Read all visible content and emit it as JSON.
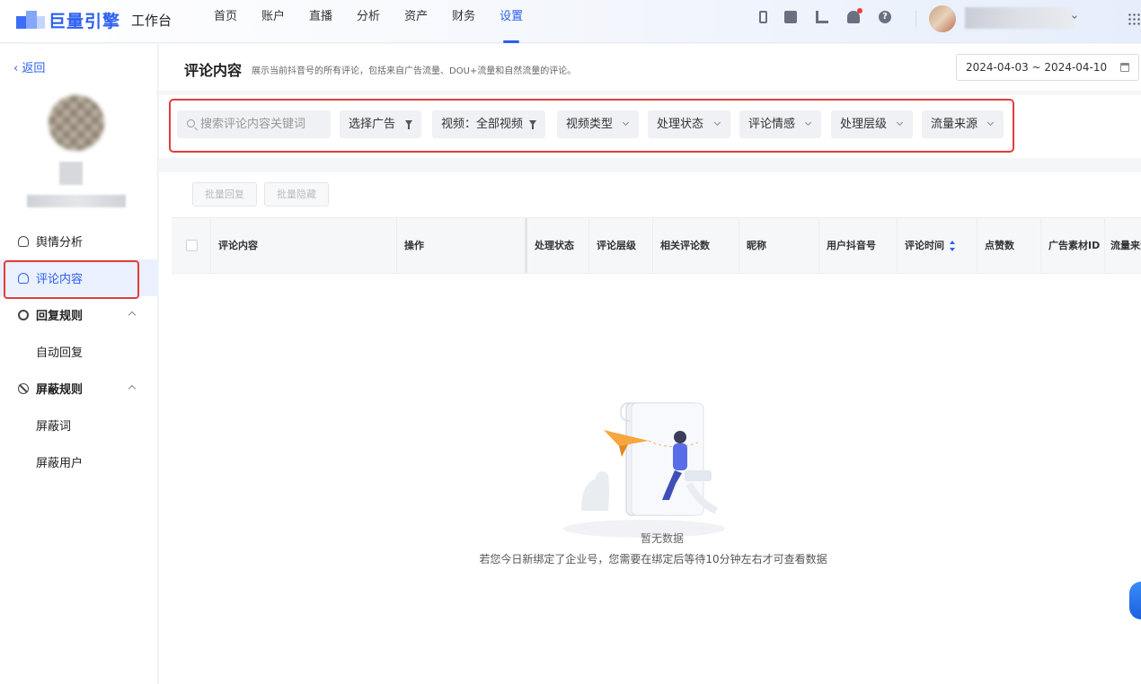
{
  "topbar": {
    "brand": "巨量引擎",
    "workspace": "工作台",
    "nav": [
      "首页",
      "账户",
      "直播",
      "分析",
      "资产",
      "财务",
      "设置"
    ],
    "active_nav_index": 6,
    "icons": [
      "phone-icon",
      "clipboard-icon",
      "chart-icon",
      "bell-icon",
      "help-icon"
    ]
  },
  "sidebar": {
    "back_label": "‹ 返回",
    "menu": [
      {
        "label": "舆情分析",
        "icon": "person-icon"
      },
      {
        "label": "评论内容",
        "icon": "person-icon",
        "active": true
      },
      {
        "label": "回复规则",
        "icon": "gear-icon",
        "bold": true
      },
      {
        "label": "自动回复",
        "sub": true
      },
      {
        "label": "屏蔽规则",
        "icon": "ban-icon",
        "bold": true
      },
      {
        "label": "屏蔽词",
        "sub": true
      },
      {
        "label": "屏蔽用户",
        "sub": true
      }
    ]
  },
  "header": {
    "title": "评论内容",
    "description": "展示当前抖音号的所有评论，包括来自广告流量、DOU+流量和自然流量的评论。",
    "date_range": "2024-04-03 ~ 2024-04-10"
  },
  "filters": {
    "search_placeholder": "搜索评论内容关键词",
    "chips": [
      "选择广告",
      "视频：全部视频",
      "视频类型",
      "处理状态",
      "评论情感",
      "处理层级",
      "流量来源"
    ]
  },
  "bulk_actions": [
    "批量回复",
    "批量隐藏"
  ],
  "table": {
    "columns": [
      "评论内容",
      "操作",
      "处理状态",
      "评论层级",
      "相关评论数",
      "昵称",
      "用户抖音号",
      "评论时间",
      "点赞数",
      "广告素材ID",
      "流量来源"
    ]
  },
  "empty": {
    "title": "暂无数据",
    "description": "若您今日新绑定了企业号，您需要在绑定后等待10分钟左右才可查看数据"
  },
  "colors": {
    "accent": "#2b5ff0",
    "highlight_box": "#e23d3d"
  }
}
